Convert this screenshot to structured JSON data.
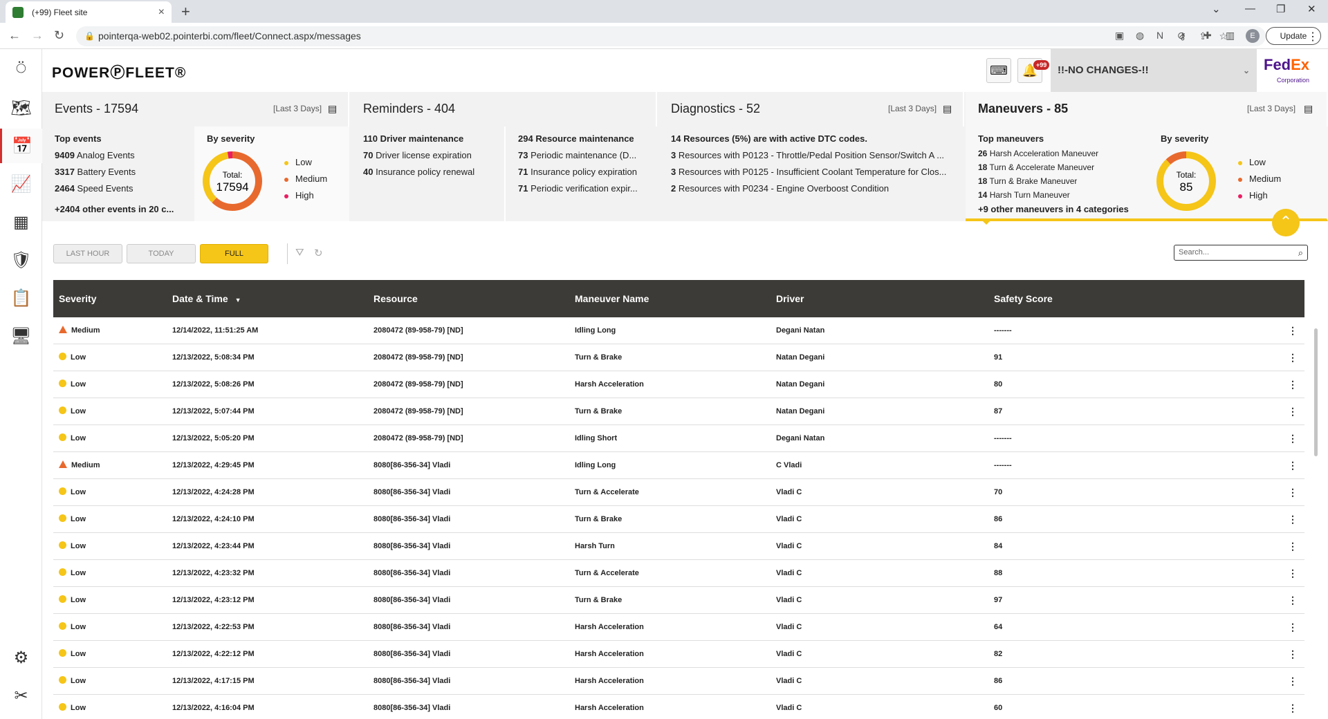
{
  "browser": {
    "tab_title": "(+99) Fleet site",
    "url": "pointerqa-web02.pointerbi.com/fleet/Connect.aspx/messages",
    "update_label": "Update",
    "avatar_letter": "E"
  },
  "header": {
    "logo": "POWERⓅFLEET®",
    "notif_badge": "+99",
    "account": "!!-NO CHANGES-!!",
    "brand_main": "Fed",
    "brand_ex": "Ex",
    "brand_sub": "Corporation"
  },
  "events": {
    "title": "Events",
    "count": "17594",
    "period": "[Last 3 Days]",
    "top_header": "Top events",
    "top": [
      {
        "n": "9409",
        "label": "Analog Events"
      },
      {
        "n": "3317",
        "label": "Battery Events"
      },
      {
        "n": "2464",
        "label": "Speed Events"
      }
    ],
    "other": "+2404 other events in 20 c...",
    "sev_header": "By severity",
    "total_label": "Total:",
    "total": "17594",
    "legend": [
      "Low",
      "Medium",
      "High"
    ],
    "severity_split": {
      "low": 0.35,
      "medium": 0.62,
      "high": 0.03
    }
  },
  "reminders": {
    "title": "Reminders",
    "count": "404",
    "col1": [
      {
        "n": "110",
        "label": "Driver maintenance",
        "bold": true
      },
      {
        "n": "70",
        "label": "Driver license expiration",
        "bold": false
      },
      {
        "n": "40",
        "label": "Insurance policy renewal",
        "bold": false
      }
    ],
    "col2": [
      {
        "n": "294",
        "label": "Resource maintenance",
        "bold": true
      },
      {
        "n": "73",
        "label": "Periodic maintenance (D...",
        "bold": false
      },
      {
        "n": "71",
        "label": "Insurance policy expiration",
        "bold": false
      },
      {
        "n": "71",
        "label": "Periodic verification expir...",
        "bold": false
      }
    ]
  },
  "diagnostics": {
    "title": "Diagnostics",
    "count": "52",
    "period": "[Last 3 Days]",
    "lines": [
      {
        "n": "14",
        "label": "Resources (5%) are with active DTC codes.",
        "bold": true
      },
      {
        "n": "3",
        "label": "Resources with P0123 - Throttle/Pedal Position Sensor/Switch A ...",
        "bold": false
      },
      {
        "n": "3",
        "label": "Resources with P0125 - Insufficient Coolant Temperature for Clos...",
        "bold": false
      },
      {
        "n": "2",
        "label": "Resources with P0234 - Engine Overboost Condition",
        "bold": false
      }
    ]
  },
  "maneuvers": {
    "title": "Maneuvers",
    "count": "85",
    "period": "[Last 3 Days]",
    "top_header": "Top maneuvers",
    "top": [
      {
        "n": "26",
        "label": "Harsh Acceleration Maneuver"
      },
      {
        "n": "18",
        "label": "Turn & Accelerate Maneuver"
      },
      {
        "n": "18",
        "label": "Turn & Brake Maneuver"
      },
      {
        "n": "14",
        "label": "Harsh Turn Maneuver"
      }
    ],
    "other": "+9 other maneuvers in 4 categories",
    "sev_header": "By severity",
    "total_label": "Total:",
    "total": "85",
    "legend": [
      "Low",
      "Medium",
      "High"
    ],
    "severity_split": {
      "low": 0.88,
      "medium": 0.12,
      "high": 0.0
    }
  },
  "filters": {
    "last_hour": "LAST HOUR",
    "today": "TODAY",
    "full": "FULL",
    "search_placeholder": "Search..."
  },
  "table": {
    "columns": [
      "Severity",
      "Date & Time",
      "Resource",
      "Maneuver Name",
      "Driver",
      "Safety Score"
    ],
    "sort_indicator": "▼",
    "rows": [
      {
        "sev": "Medium",
        "dt": "12/14/2022, 11:51:25 AM",
        "res": "2080472 (89-958-79) [ND]",
        "man": "Idling Long",
        "drv": "Degani Natan",
        "score": "-------"
      },
      {
        "sev": "Low",
        "dt": "12/13/2022, 5:08:34 PM",
        "res": "2080472 (89-958-79) [ND]",
        "man": "Turn & Brake",
        "drv": "Natan Degani",
        "score": "91"
      },
      {
        "sev": "Low",
        "dt": "12/13/2022, 5:08:26 PM",
        "res": "2080472 (89-958-79) [ND]",
        "man": "Harsh Acceleration",
        "drv": "Natan Degani",
        "score": "80"
      },
      {
        "sev": "Low",
        "dt": "12/13/2022, 5:07:44 PM",
        "res": "2080472 (89-958-79) [ND]",
        "man": "Turn & Brake",
        "drv": "Natan Degani",
        "score": "87"
      },
      {
        "sev": "Low",
        "dt": "12/13/2022, 5:05:20 PM",
        "res": "2080472 (89-958-79) [ND]",
        "man": "Idling Short",
        "drv": "Degani Natan",
        "score": "-------"
      },
      {
        "sev": "Medium",
        "dt": "12/13/2022, 4:29:45 PM",
        "res": "8080[86-356-34] Vladi",
        "man": "Idling Long",
        "drv": "C Vladi",
        "score": "-------"
      },
      {
        "sev": "Low",
        "dt": "12/13/2022, 4:24:28 PM",
        "res": "8080[86-356-34] Vladi",
        "man": "Turn & Accelerate",
        "drv": "Vladi C",
        "score": "70"
      },
      {
        "sev": "Low",
        "dt": "12/13/2022, 4:24:10 PM",
        "res": "8080[86-356-34] Vladi",
        "man": "Turn & Brake",
        "drv": "Vladi C",
        "score": "86"
      },
      {
        "sev": "Low",
        "dt": "12/13/2022, 4:23:44 PM",
        "res": "8080[86-356-34] Vladi",
        "man": "Harsh Turn",
        "drv": "Vladi C",
        "score": "84"
      },
      {
        "sev": "Low",
        "dt": "12/13/2022, 4:23:32 PM",
        "res": "8080[86-356-34] Vladi",
        "man": "Turn & Accelerate",
        "drv": "Vladi C",
        "score": "88"
      },
      {
        "sev": "Low",
        "dt": "12/13/2022, 4:23:12 PM",
        "res": "8080[86-356-34] Vladi",
        "man": "Turn & Brake",
        "drv": "Vladi C",
        "score": "97"
      },
      {
        "sev": "Low",
        "dt": "12/13/2022, 4:22:53 PM",
        "res": "8080[86-356-34] Vladi",
        "man": "Harsh Acceleration",
        "drv": "Vladi C",
        "score": "64"
      },
      {
        "sev": "Low",
        "dt": "12/13/2022, 4:22:12 PM",
        "res": "8080[86-356-34] Vladi",
        "man": "Harsh Acceleration",
        "drv": "Vladi C",
        "score": "82"
      },
      {
        "sev": "Low",
        "dt": "12/13/2022, 4:17:15 PM",
        "res": "8080[86-356-34] Vladi",
        "man": "Harsh Acceleration",
        "drv": "Vladi C",
        "score": "86"
      },
      {
        "sev": "Low",
        "dt": "12/13/2022, 4:16:04 PM",
        "res": "8080[86-356-34] Vladi",
        "man": "Harsh Acceleration",
        "drv": "Vladi C",
        "score": "60"
      }
    ]
  },
  "colors": {
    "accent": "#f5c518",
    "low": "#f5c518",
    "medium": "#e8692d",
    "high": "#e91e63",
    "header_bg": "#3d3b37",
    "active_nav": "#c62828"
  },
  "sidebar_icons": [
    "pointer-logo-icon",
    "map-icon",
    "calendar-star-icon",
    "trend-chart-icon",
    "dashboard-icon",
    "shield-check-icon",
    "clipboard-icon",
    "monitor-upload-icon",
    "settings-icon",
    "tools-icon"
  ]
}
